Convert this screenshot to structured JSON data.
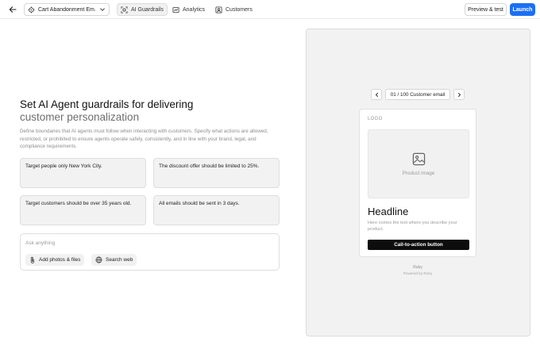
{
  "header": {
    "project_name": "Cart Abandonment Em...",
    "tabs": [
      {
        "label": "AI Guardrails",
        "icon": "shield-scan-icon",
        "active": true
      },
      {
        "label": "Analytics",
        "icon": "chart-icon",
        "active": false
      },
      {
        "label": "Customers",
        "icon": "user-card-icon",
        "active": false
      }
    ],
    "preview_label": "Preview & test",
    "launch_label": "Launch",
    "accent": "#1d6ff2"
  },
  "main": {
    "title_line1": "Set AI Agent guardrails for delivering",
    "title_line2": "customer personalization",
    "description": "Define boundaries that AI agents must follow when interacting with customers. Specify what actions are allowed, restricted, or prohibited to ensure agents operate safely, consistently, and in line with your brand, legal, and compliance requirements.",
    "guardrails": [
      "Target people only New York City.",
      "The discount offer should be limited to 25%.",
      "Target customers should be over 35 years old.",
      "All emails should be sent in 3 days."
    ],
    "ask": {
      "placeholder": "Ask anything",
      "add_label": "Add photos & files",
      "search_label": "Search web"
    }
  },
  "preview": {
    "pager_label": "01 / 100 Customer email",
    "logo_text": "LOGO",
    "image_caption": "Product image",
    "headline": "Headline",
    "subtext": "Here comes the text where you describe your product.",
    "cta_label": "Call-to-action button",
    "brand": "Ruby",
    "powered_by": "Powered by Ruby"
  }
}
